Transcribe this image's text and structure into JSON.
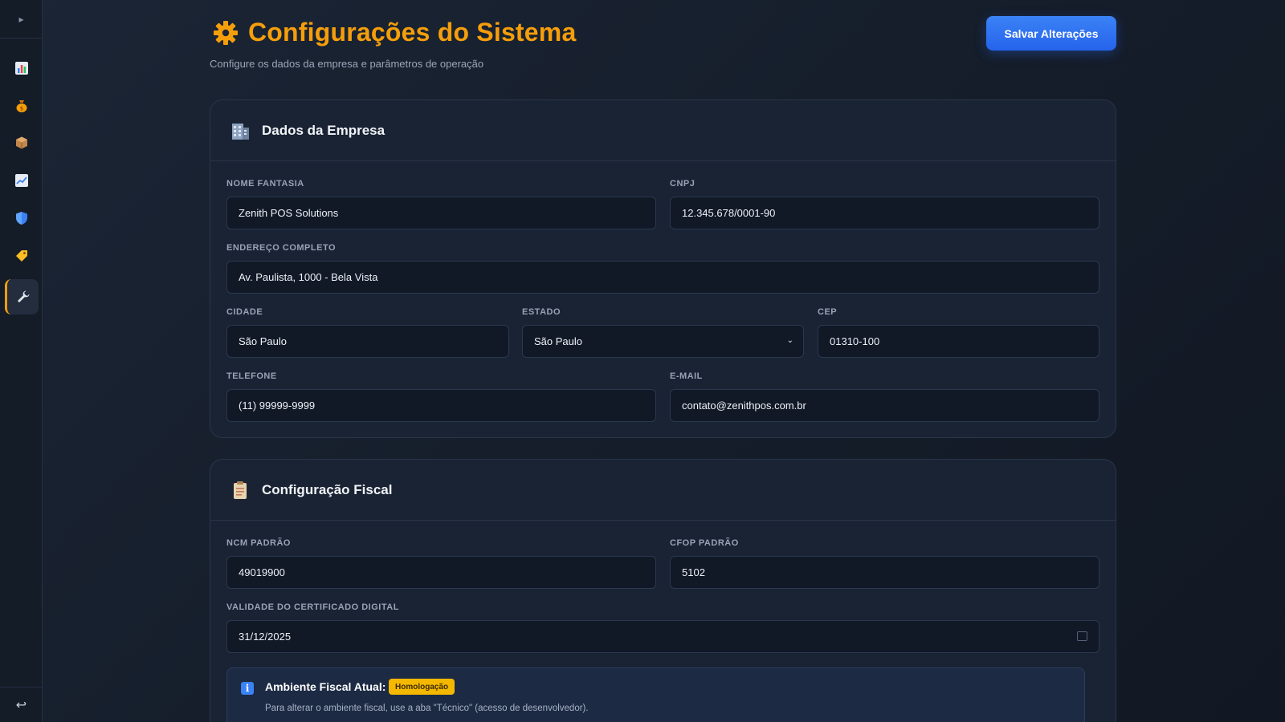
{
  "header": {
    "title": "Configurações do Sistema",
    "subtitle": "Configure os dados da empresa e parâmetros de operação",
    "save_label": "Salvar Alterações",
    "title_icon": "gear-icon",
    "accent_color": "#f59e0b"
  },
  "sidebar": {
    "toggle": "▸",
    "items": [
      {
        "name": "dashboard",
        "icon": "bar-chart-icon"
      },
      {
        "name": "finance",
        "icon": "money-bag-icon"
      },
      {
        "name": "inventory",
        "icon": "package-icon"
      },
      {
        "name": "reports",
        "icon": "line-chart-icon"
      },
      {
        "name": "security",
        "icon": "shield-icon"
      },
      {
        "name": "promotions",
        "icon": "tag-icon"
      },
      {
        "name": "settings",
        "icon": "wrench-icon",
        "active": true
      }
    ],
    "logout": "↩"
  },
  "company": {
    "title": "Dados da Empresa",
    "icon": "building-icon",
    "fields": {
      "nome_fantasia": {
        "label": "NOME FANTASIA",
        "value": "Zenith POS Solutions"
      },
      "cnpj": {
        "label": "CNPJ",
        "value": "12.345.678/0001-90"
      },
      "endereco": {
        "label": "ENDEREÇO COMPLETO",
        "value": "Av. Paulista, 1000 - Bela Vista"
      },
      "cidade": {
        "label": "CIDADE",
        "value": "São Paulo"
      },
      "estado": {
        "label": "ESTADO",
        "value": "São Paulo"
      },
      "cep": {
        "label": "CEP",
        "value": "01310-100"
      },
      "telefone": {
        "label": "TELEFONE",
        "value": "(11) 99999-9999"
      },
      "email": {
        "label": "E-MAIL",
        "value": "contato@zenithpos.com.br"
      }
    }
  },
  "fiscal": {
    "title": "Configuração Fiscal",
    "icon": "clipboard-icon",
    "fields": {
      "ncm": {
        "label": "NCM PADRÃO",
        "value": "49019900"
      },
      "cfop": {
        "label": "CFOP PADRÃO",
        "value": "5102"
      },
      "validade": {
        "label": "VALIDADE DO CERTIFICADO DIGITAL",
        "value": "31/12/2025"
      }
    },
    "info": {
      "title": "Ambiente Fiscal Atual:",
      "badge": "Homologação",
      "badge_color": "#f5b800",
      "description": "Para alterar o ambiente fiscal, use a aba \"Técnico\" (acesso de desenvolvedor)."
    }
  }
}
